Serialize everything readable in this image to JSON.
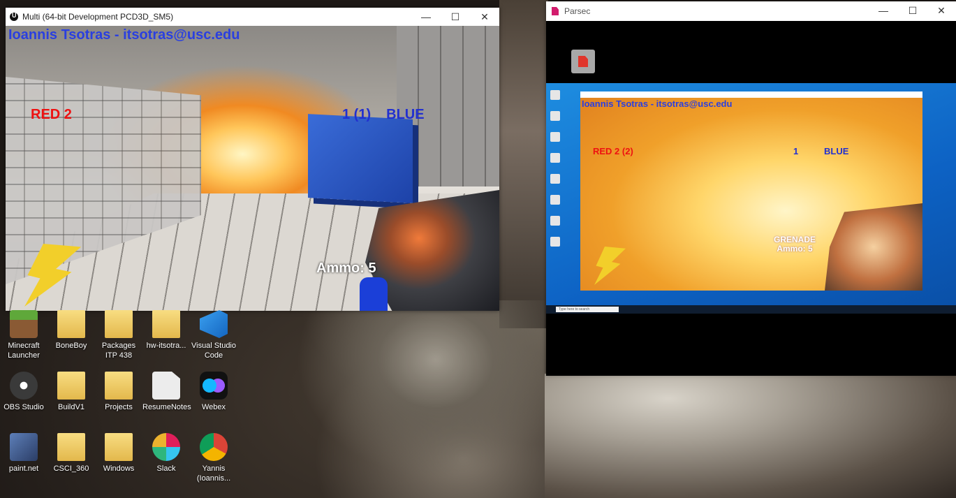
{
  "colors": {
    "hud_red": "#e11111",
    "hud_blue": "#2230d0",
    "name_blue": "#2a3fe0",
    "parsec_pink": "#d21c6d"
  },
  "game_window": {
    "title": "Multi (64-bit Development PCD3D_SM5)",
    "controls": {
      "minimize": "—",
      "maximize": "☐",
      "close": "✕"
    },
    "hud": {
      "player_name": "Ioannis Tsotras - itsotras@usc.edu",
      "red_score": "RED  2",
      "blue_score": "1 (1)",
      "blue_label": "BLUE",
      "ammo": "Ammo: 5"
    }
  },
  "parsec_window": {
    "title": "Parsec",
    "controls": {
      "minimize": "—",
      "maximize": "☐",
      "close": "✕"
    },
    "remote": {
      "player_name": "Ioannis Tsotras - itsotras@usc.edu",
      "red_score": "RED  2 (2)",
      "blue_score": "1",
      "blue_label": "BLUE",
      "weapon": "GRENADE",
      "ammo": "Ammo: 5",
      "search_placeholder": "Type here to search"
    }
  },
  "desktop_icons": [
    {
      "label": "Minecraft Launcher",
      "icon": "minecraft-icon"
    },
    {
      "label": "BoneBoy",
      "icon": "folder-icon"
    },
    {
      "label": "Packages ITP 438",
      "icon": "folder-icon"
    },
    {
      "label": "hw-itsotra...",
      "icon": "folder-icon"
    },
    {
      "label": "Visual Studio Code",
      "icon": "vscode-icon"
    },
    {
      "label": "OBS Studio",
      "icon": "obs-icon"
    },
    {
      "label": "BuildV1",
      "icon": "folder-icon"
    },
    {
      "label": "Projects",
      "icon": "folder-icon"
    },
    {
      "label": "ResumeNotes",
      "icon": "document-icon"
    },
    {
      "label": "Webex",
      "icon": "webex-icon"
    },
    {
      "label": "paint.net",
      "icon": "paint-icon"
    },
    {
      "label": "CSCI_360",
      "icon": "folder-icon"
    },
    {
      "label": "Windows",
      "icon": "folder-icon"
    },
    {
      "label": "Slack",
      "icon": "slack-icon"
    },
    {
      "label": "Yannis (Ioannis...",
      "icon": "chrome-icon"
    }
  ]
}
